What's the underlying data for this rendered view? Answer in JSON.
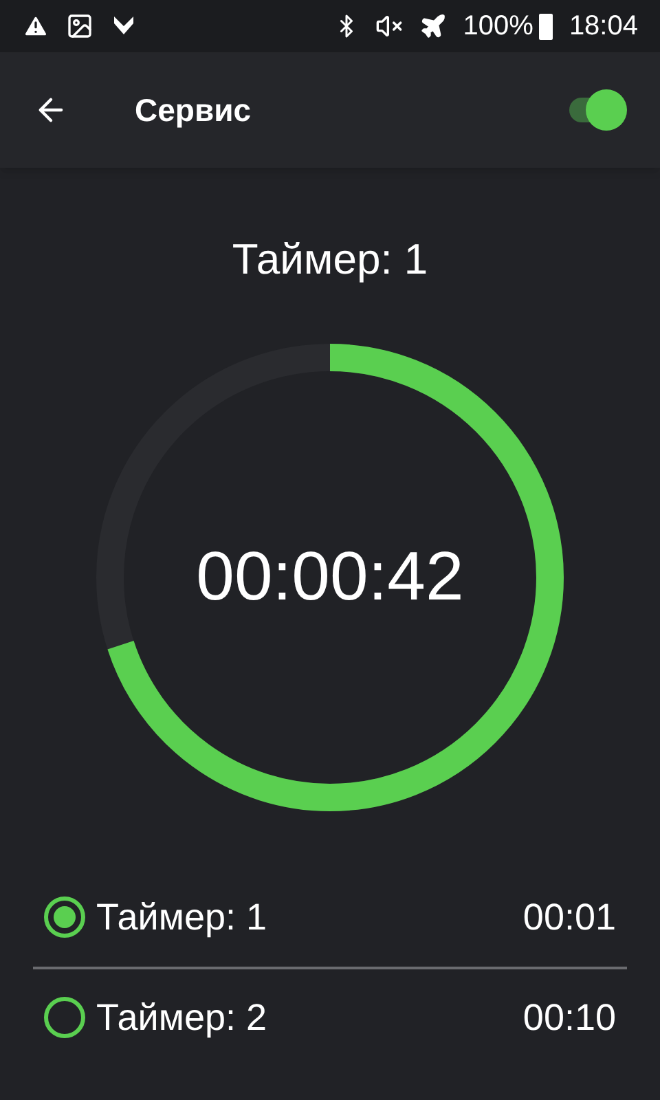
{
  "status_bar": {
    "battery": "100%",
    "time": "18:04"
  },
  "header": {
    "title": "Сервис",
    "switch_on": true
  },
  "timer": {
    "title": "Таймер: 1",
    "time": "00:00:42",
    "level": 0.7
  },
  "timers": [
    {
      "label": "Таймер: 1",
      "duration": "00:01",
      "selected": true
    },
    {
      "label": "Таймер: 2",
      "duration": "00:10",
      "selected": false
    }
  ]
}
